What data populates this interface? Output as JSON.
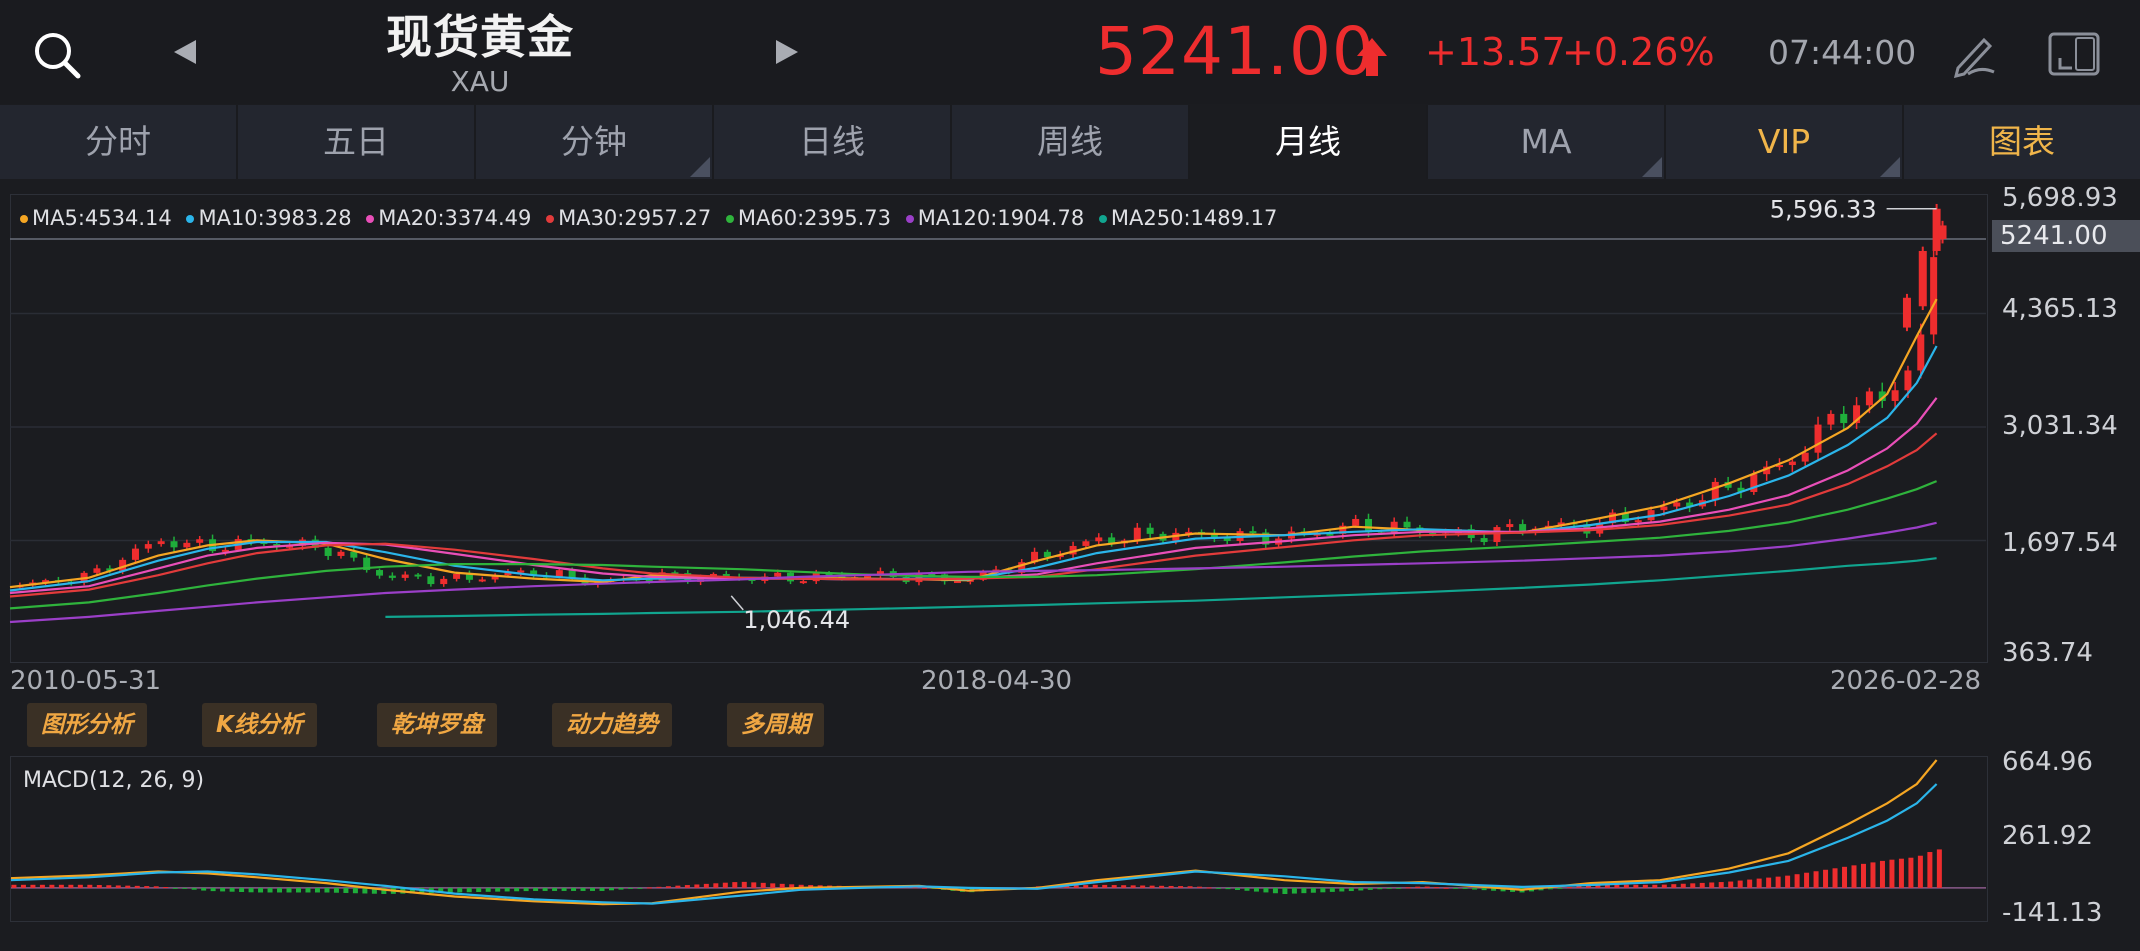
{
  "header": {
    "title": "现货黄金",
    "code": "XAU",
    "price": "5241.00",
    "change": "+13.57",
    "change_pct": "+0.26%",
    "time": "07:44:00"
  },
  "colors": {
    "up": "#ee2d2e",
    "down": "#1fae3b",
    "gold": "#f0b54a",
    "bg": "#1b1c20"
  },
  "icons": {
    "search": "search-icon",
    "prev": "triangle-left-icon",
    "next": "triangle-right-icon",
    "up": "up-arrow-icon",
    "pen": "pen-icon",
    "rotate": "rotate-screen-icon"
  },
  "tabs": [
    {
      "label": "分时"
    },
    {
      "label": "五日"
    },
    {
      "label": "分钟"
    },
    {
      "label": "日线"
    },
    {
      "label": "周线"
    },
    {
      "label": "月线"
    },
    {
      "label": "MA"
    },
    {
      "label": "VIP"
    },
    {
      "label": "图表"
    }
  ],
  "ma_legend": [
    {
      "label": "MA5:4534.14",
      "color": "#f5a623"
    },
    {
      "label": "MA10:3983.28",
      "color": "#2bb5ea"
    },
    {
      "label": "MA20:3374.49",
      "color": "#e94fb8"
    },
    {
      "label": "MA30:2957.27",
      "color": "#e23b3b"
    },
    {
      "label": "MA60:2395.73",
      "color": "#2fb33c"
    },
    {
      "label": "MA120:1904.78",
      "color": "#9b3fc8"
    },
    {
      "label": "MA250:1489.17",
      "color": "#11a58f"
    }
  ],
  "main_axis": {
    "ticks": [
      "5,698.93",
      "4,365.13",
      "3,031.34",
      "1,697.54",
      "363.74"
    ],
    "current_price": "5241.00",
    "x_labels": [
      "2010-05-31",
      "2018-04-30",
      "2026-02-28"
    ],
    "high_label": "5,596.33",
    "low_label": "1,046.44"
  },
  "tools": [
    {
      "label": "图形分析"
    },
    {
      "label": "K线分析"
    },
    {
      "label": "乾坤罗盘"
    },
    {
      "label": "动力趋势"
    },
    {
      "label": "多周期"
    }
  ],
  "macd": {
    "label": "MACD(12, 26, 9)",
    "ticks": [
      "664.96",
      "261.92",
      "-141.13"
    ]
  },
  "chart_data": {
    "type": "candlestick",
    "ylim": [
      363.74,
      5698.93
    ],
    "x_range": [
      "2010-05-31",
      "2026-02-28"
    ],
    "ma_lines": {
      "MA5": [
        [
          0,
          1150
        ],
        [
          40,
          1260
        ],
        [
          75,
          1520
        ],
        [
          100,
          1640
        ],
        [
          125,
          1700
        ],
        [
          160,
          1660
        ],
        [
          190,
          1480
        ],
        [
          225,
          1320
        ],
        [
          265,
          1250
        ],
        [
          300,
          1210
        ],
        [
          325,
          1290
        ],
        [
          370,
          1250
        ],
        [
          400,
          1260
        ],
        [
          430,
          1250
        ],
        [
          460,
          1240
        ],
        [
          485,
          1230
        ],
        [
          520,
          1460
        ],
        [
          550,
          1640
        ],
        [
          600,
          1780
        ],
        [
          645,
          1760
        ],
        [
          680,
          1860
        ],
        [
          715,
          1820
        ],
        [
          765,
          1790
        ],
        [
          800,
          1940
        ],
        [
          835,
          2100
        ],
        [
          870,
          2370
        ],
        [
          900,
          2640
        ],
        [
          930,
          3020
        ],
        [
          950,
          3420
        ],
        [
          965,
          4100
        ],
        [
          975,
          4534
        ]
      ],
      "MA10": [
        [
          0,
          1110
        ],
        [
          40,
          1220
        ],
        [
          75,
          1460
        ],
        [
          100,
          1600
        ],
        [
          125,
          1680
        ],
        [
          160,
          1680
        ],
        [
          190,
          1560
        ],
        [
          225,
          1400
        ],
        [
          265,
          1290
        ],
        [
          300,
          1230
        ],
        [
          325,
          1250
        ],
        [
          370,
          1260
        ],
        [
          400,
          1250
        ],
        [
          430,
          1240
        ],
        [
          460,
          1250
        ],
        [
          485,
          1240
        ],
        [
          520,
          1380
        ],
        [
          550,
          1550
        ],
        [
          600,
          1720
        ],
        [
          645,
          1760
        ],
        [
          680,
          1800
        ],
        [
          715,
          1830
        ],
        [
          765,
          1790
        ],
        [
          800,
          1880
        ],
        [
          835,
          2000
        ],
        [
          870,
          2220
        ],
        [
          900,
          2460
        ],
        [
          930,
          2820
        ],
        [
          950,
          3140
        ],
        [
          965,
          3550
        ],
        [
          975,
          3983
        ]
      ],
      "MA20": [
        [
          0,
          1080
        ],
        [
          40,
          1160
        ],
        [
          75,
          1370
        ],
        [
          100,
          1520
        ],
        [
          125,
          1610
        ],
        [
          160,
          1670
        ],
        [
          190,
          1650
        ],
        [
          225,
          1540
        ],
        [
          265,
          1410
        ],
        [
          300,
          1310
        ],
        [
          325,
          1270
        ],
        [
          370,
          1250
        ],
        [
          400,
          1250
        ],
        [
          430,
          1240
        ],
        [
          460,
          1240
        ],
        [
          485,
          1250
        ],
        [
          520,
          1300
        ],
        [
          550,
          1430
        ],
        [
          600,
          1610
        ],
        [
          645,
          1690
        ],
        [
          680,
          1760
        ],
        [
          715,
          1800
        ],
        [
          765,
          1800
        ],
        [
          800,
          1840
        ],
        [
          835,
          1920
        ],
        [
          870,
          2060
        ],
        [
          900,
          2230
        ],
        [
          930,
          2520
        ],
        [
          950,
          2780
        ],
        [
          965,
          3070
        ],
        [
          975,
          3374
        ]
      ],
      "MA30": [
        [
          0,
          1040
        ],
        [
          40,
          1120
        ],
        [
          75,
          1290
        ],
        [
          100,
          1430
        ],
        [
          125,
          1550
        ],
        [
          160,
          1640
        ],
        [
          190,
          1660
        ],
        [
          225,
          1590
        ],
        [
          265,
          1480
        ],
        [
          300,
          1370
        ],
        [
          325,
          1310
        ],
        [
          370,
          1260
        ],
        [
          400,
          1250
        ],
        [
          430,
          1240
        ],
        [
          460,
          1240
        ],
        [
          485,
          1250
        ],
        [
          520,
          1270
        ],
        [
          550,
          1360
        ],
        [
          600,
          1520
        ],
        [
          645,
          1620
        ],
        [
          680,
          1700
        ],
        [
          715,
          1760
        ],
        [
          765,
          1790
        ],
        [
          800,
          1820
        ],
        [
          835,
          1880
        ],
        [
          870,
          1990
        ],
        [
          900,
          2120
        ],
        [
          930,
          2360
        ],
        [
          950,
          2570
        ],
        [
          965,
          2760
        ],
        [
          975,
          2957
        ]
      ],
      "MA60": [
        [
          0,
          900
        ],
        [
          40,
          970
        ],
        [
          75,
          1080
        ],
        [
          100,
          1170
        ],
        [
          125,
          1250
        ],
        [
          160,
          1340
        ],
        [
          190,
          1390
        ],
        [
          225,
          1420
        ],
        [
          265,
          1420
        ],
        [
          300,
          1410
        ],
        [
          325,
          1390
        ],
        [
          370,
          1360
        ],
        [
          400,
          1330
        ],
        [
          430,
          1300
        ],
        [
          460,
          1280
        ],
        [
          485,
          1270
        ],
        [
          520,
          1270
        ],
        [
          550,
          1290
        ],
        [
          600,
          1360
        ],
        [
          645,
          1440
        ],
        [
          680,
          1510
        ],
        [
          715,
          1570
        ],
        [
          765,
          1630
        ],
        [
          800,
          1680
        ],
        [
          835,
          1730
        ],
        [
          870,
          1810
        ],
        [
          900,
          1910
        ],
        [
          930,
          2060
        ],
        [
          950,
          2190
        ],
        [
          965,
          2300
        ],
        [
          975,
          2396
        ]
      ],
      "MA120": [
        [
          0,
          740
        ],
        [
          40,
          800
        ],
        [
          75,
          870
        ],
        [
          100,
          920
        ],
        [
          125,
          970
        ],
        [
          160,
          1030
        ],
        [
          190,
          1080
        ],
        [
          225,
          1120
        ],
        [
          265,
          1160
        ],
        [
          300,
          1190
        ],
        [
          325,
          1210
        ],
        [
          370,
          1240
        ],
        [
          400,
          1270
        ],
        [
          430,
          1290
        ],
        [
          460,
          1310
        ],
        [
          485,
          1330
        ],
        [
          520,
          1340
        ],
        [
          550,
          1350
        ],
        [
          600,
          1370
        ],
        [
          645,
          1390
        ],
        [
          680,
          1410
        ],
        [
          715,
          1430
        ],
        [
          765,
          1460
        ],
        [
          800,
          1490
        ],
        [
          835,
          1520
        ],
        [
          870,
          1570
        ],
        [
          900,
          1630
        ],
        [
          930,
          1720
        ],
        [
          950,
          1790
        ],
        [
          965,
          1850
        ],
        [
          975,
          1905
        ]
      ],
      "MA250": [
        [
          190,
          800
        ],
        [
          225,
          810
        ],
        [
          265,
          825
        ],
        [
          300,
          835
        ],
        [
          325,
          845
        ],
        [
          370,
          860
        ],
        [
          400,
          875
        ],
        [
          430,
          890
        ],
        [
          460,
          905
        ],
        [
          485,
          920
        ],
        [
          520,
          940
        ],
        [
          550,
          960
        ],
        [
          600,
          990
        ],
        [
          645,
          1030
        ],
        [
          680,
          1060
        ],
        [
          715,
          1090
        ],
        [
          765,
          1140
        ],
        [
          800,
          1180
        ],
        [
          835,
          1230
        ],
        [
          870,
          1290
        ],
        [
          900,
          1340
        ],
        [
          930,
          1400
        ],
        [
          950,
          1430
        ],
        [
          965,
          1460
        ],
        [
          975,
          1489
        ]
      ]
    },
    "price_path": [
      [
        0,
        1150
      ],
      [
        40,
        1280
      ],
      [
        75,
        1700
      ],
      [
        100,
        1620
      ],
      [
        125,
        1680
      ],
      [
        160,
        1610
      ],
      [
        190,
        1270
      ],
      [
        225,
        1240
      ],
      [
        265,
        1330
      ],
      [
        300,
        1200
      ],
      [
        325,
        1280
      ],
      [
        370,
        1260
      ],
      [
        400,
        1260
      ],
      [
        430,
        1290
      ],
      [
        460,
        1270
      ],
      [
        485,
        1230
      ],
      [
        520,
        1500
      ],
      [
        550,
        1700
      ],
      [
        580,
        1780
      ],
      [
        600,
        1760
      ],
      [
        645,
        1730
      ],
      [
        680,
        1870
      ],
      [
        715,
        1820
      ],
      [
        740,
        1740
      ],
      [
        765,
        1860
      ],
      [
        800,
        1870
      ],
      [
        835,
        2050
      ],
      [
        870,
        2320
      ],
      [
        900,
        2620
      ],
      [
        930,
        3290
      ],
      [
        950,
        3350
      ],
      [
        960,
        3750
      ],
      [
        970,
        4200
      ],
      [
        975,
        5100
      ],
      [
        978,
        5241
      ]
    ],
    "high_point": {
      "x": 975,
      "value": 5596.33
    },
    "low_point": {
      "x": 365,
      "value": 1046.44
    },
    "macd": {
      "ylim": [
        -141.13,
        664.96
      ],
      "dif": [
        [
          0,
          50
        ],
        [
          40,
          65
        ],
        [
          75,
          85
        ],
        [
          100,
          75
        ],
        [
          125,
          55
        ],
        [
          160,
          25
        ],
        [
          190,
          -10
        ],
        [
          225,
          -45
        ],
        [
          265,
          -70
        ],
        [
          300,
          -85
        ],
        [
          325,
          -80
        ],
        [
          370,
          -20
        ],
        [
          400,
          0
        ],
        [
          430,
          5
        ],
        [
          460,
          10
        ],
        [
          485,
          -15
        ],
        [
          520,
          0
        ],
        [
          550,
          40
        ],
        [
          600,
          90
        ],
        [
          645,
          40
        ],
        [
          680,
          20
        ],
        [
          715,
          30
        ],
        [
          765,
          -10
        ],
        [
          800,
          25
        ],
        [
          835,
          40
        ],
        [
          870,
          100
        ],
        [
          900,
          180
        ],
        [
          930,
          330
        ],
        [
          950,
          440
        ],
        [
          965,
          540
        ],
        [
          975,
          664.96
        ]
      ],
      "dea": [
        [
          0,
          40
        ],
        [
          40,
          55
        ],
        [
          75,
          80
        ],
        [
          100,
          85
        ],
        [
          125,
          70
        ],
        [
          160,
          40
        ],
        [
          190,
          10
        ],
        [
          225,
          -30
        ],
        [
          265,
          -60
        ],
        [
          300,
          -75
        ],
        [
          325,
          -82
        ],
        [
          370,
          -40
        ],
        [
          400,
          -10
        ],
        [
          430,
          0
        ],
        [
          460,
          8
        ],
        [
          485,
          0
        ],
        [
          520,
          -5
        ],
        [
          550,
          30
        ],
        [
          600,
          85
        ],
        [
          645,
          60
        ],
        [
          680,
          30
        ],
        [
          715,
          25
        ],
        [
          765,
          5
        ],
        [
          800,
          15
        ],
        [
          835,
          30
        ],
        [
          870,
          80
        ],
        [
          900,
          140
        ],
        [
          930,
          260
        ],
        [
          950,
          350
        ],
        [
          965,
          440
        ],
        [
          975,
          540
        ]
      ]
    }
  }
}
